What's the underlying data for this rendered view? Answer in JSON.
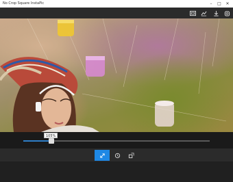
{
  "window": {
    "title": "No Crop Square InstaPic",
    "minimize_icon": "minimize-icon",
    "maximize_icon": "maximize-icon",
    "close_icon": "close-icon"
  },
  "toolbar": {
    "icons": [
      "image-size-icon",
      "adjust-icon",
      "download-icon",
      "share-icon"
    ]
  },
  "zoom": {
    "label": "105%",
    "level": 0.15
  },
  "bottom_toolbar": {
    "buttons": [
      {
        "name": "fit-icon",
        "active": true
      },
      {
        "name": "rotate-icon",
        "active": false
      },
      {
        "name": "crop-icon",
        "active": false
      }
    ]
  },
  "colors": {
    "accent": "#1e88e5",
    "slider_fill": "#2f7fc8"
  }
}
